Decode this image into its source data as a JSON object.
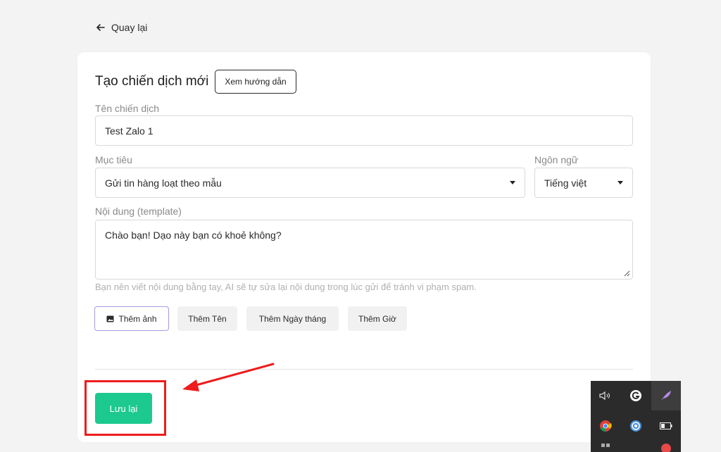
{
  "nav": {
    "back_label": "Quay lại"
  },
  "form": {
    "title": "Tạo chiến dịch mới",
    "guide_button": "Xem hướng dẫn",
    "campaign_name": {
      "label": "Tên chiến dịch",
      "value": "Test Zalo 1"
    },
    "goal": {
      "label": "Mục tiêu",
      "value": "Gửi tin hàng loạt theo mẫu"
    },
    "language": {
      "label": "Ngôn ngữ",
      "value": "Tiếng việt"
    },
    "content": {
      "label": "Nội dung (template)",
      "value": "Chào bạn! Dạo này bạn có khoẻ không?"
    },
    "hint": "Bạn nên viết nội dung bằng tay, AI sẽ tự sửa lại nội dung trong lúc gửi để tránh vi phạm spam.",
    "chips": [
      {
        "label": "Thêm ảnh",
        "icon": "image-icon",
        "active": true
      },
      {
        "label": "Thêm Tên"
      },
      {
        "label": "Thêm Ngày tháng"
      },
      {
        "label": "Thêm Giờ"
      }
    ],
    "save_button": "Lưu lại"
  },
  "annotation": {
    "highlight_color": "#ee1c1c"
  },
  "colors": {
    "save_button": "#1cc98e",
    "active_chip_border": "#a59ce0"
  },
  "tray": {
    "icons": [
      "volume-icon",
      "g-app-icon",
      "feather-icon",
      "chrome-icon",
      "globe-app-icon",
      "battery-icon"
    ]
  }
}
